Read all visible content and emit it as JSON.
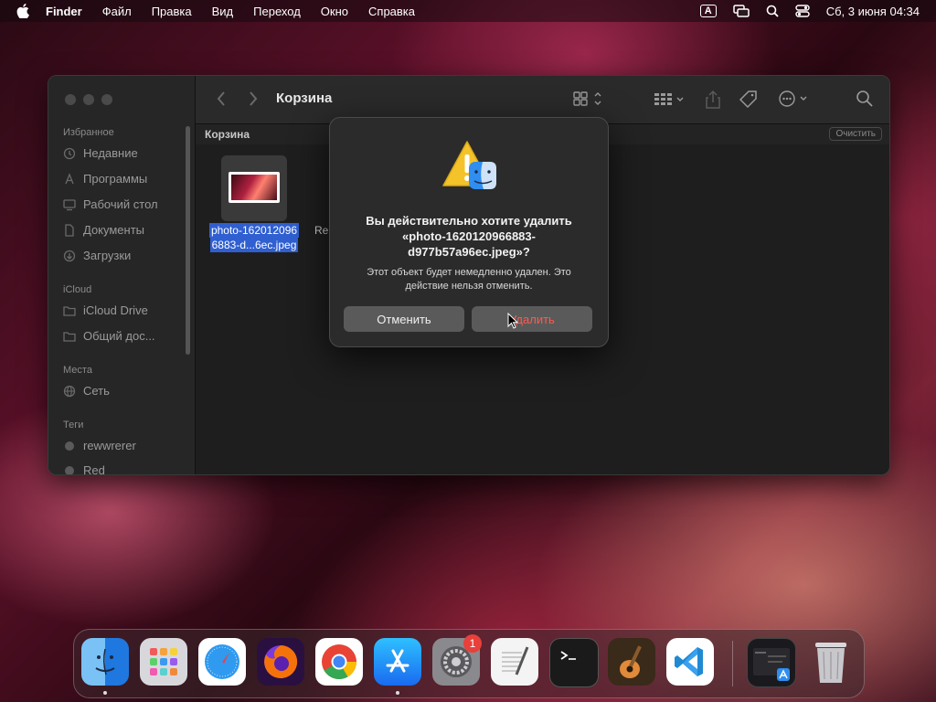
{
  "menubar": {
    "app_name": "Finder",
    "items": [
      "Файл",
      "Правка",
      "Вид",
      "Переход",
      "Окно",
      "Справка"
    ],
    "input_indicator": "A",
    "datetime": "Сб, 3 июня  04:34"
  },
  "finder": {
    "title": "Корзина",
    "path_label": "Корзина",
    "empty_button": "Очистить",
    "sidebar": {
      "favorites_header": "Избранное",
      "favorites": [
        "Недавние",
        "Программы",
        "Рабочий стол",
        "Документы",
        "Загрузки"
      ],
      "icloud_header": "iCloud",
      "icloud": [
        "iCloud Drive",
        "Общий дос..."
      ],
      "locations_header": "Места",
      "locations": [
        "Сеть"
      ],
      "tags_header": "Теги",
      "tags": [
        "rewwrerer",
        "Red"
      ]
    },
    "file": {
      "name_line1": "photo-162012096",
      "name_line2": "6883-d...6ec.jpeg"
    },
    "peek_text": "Re"
  },
  "dialog": {
    "title": "Вы действительно хотите удалить «photo-1620120966883-d977b57a96ec.jpeg»?",
    "message": "Этот объект будет немедленно удален. Это действие нельзя отменить.",
    "cancel_label": "Отменить",
    "delete_label": "Удалить"
  },
  "dock": {
    "apps": [
      "Finder",
      "Launchpad",
      "Safari",
      "Firefox",
      "Chrome",
      "App Store",
      "System Preferences",
      "TextEdit",
      "Terminal",
      "GarageBand",
      "Visual Studio Code"
    ],
    "settings_badge": "1"
  },
  "colors": {
    "accent": "#2f5fd0",
    "destructive": "#ff5a4f",
    "window_bg": "#1e1e1e"
  }
}
